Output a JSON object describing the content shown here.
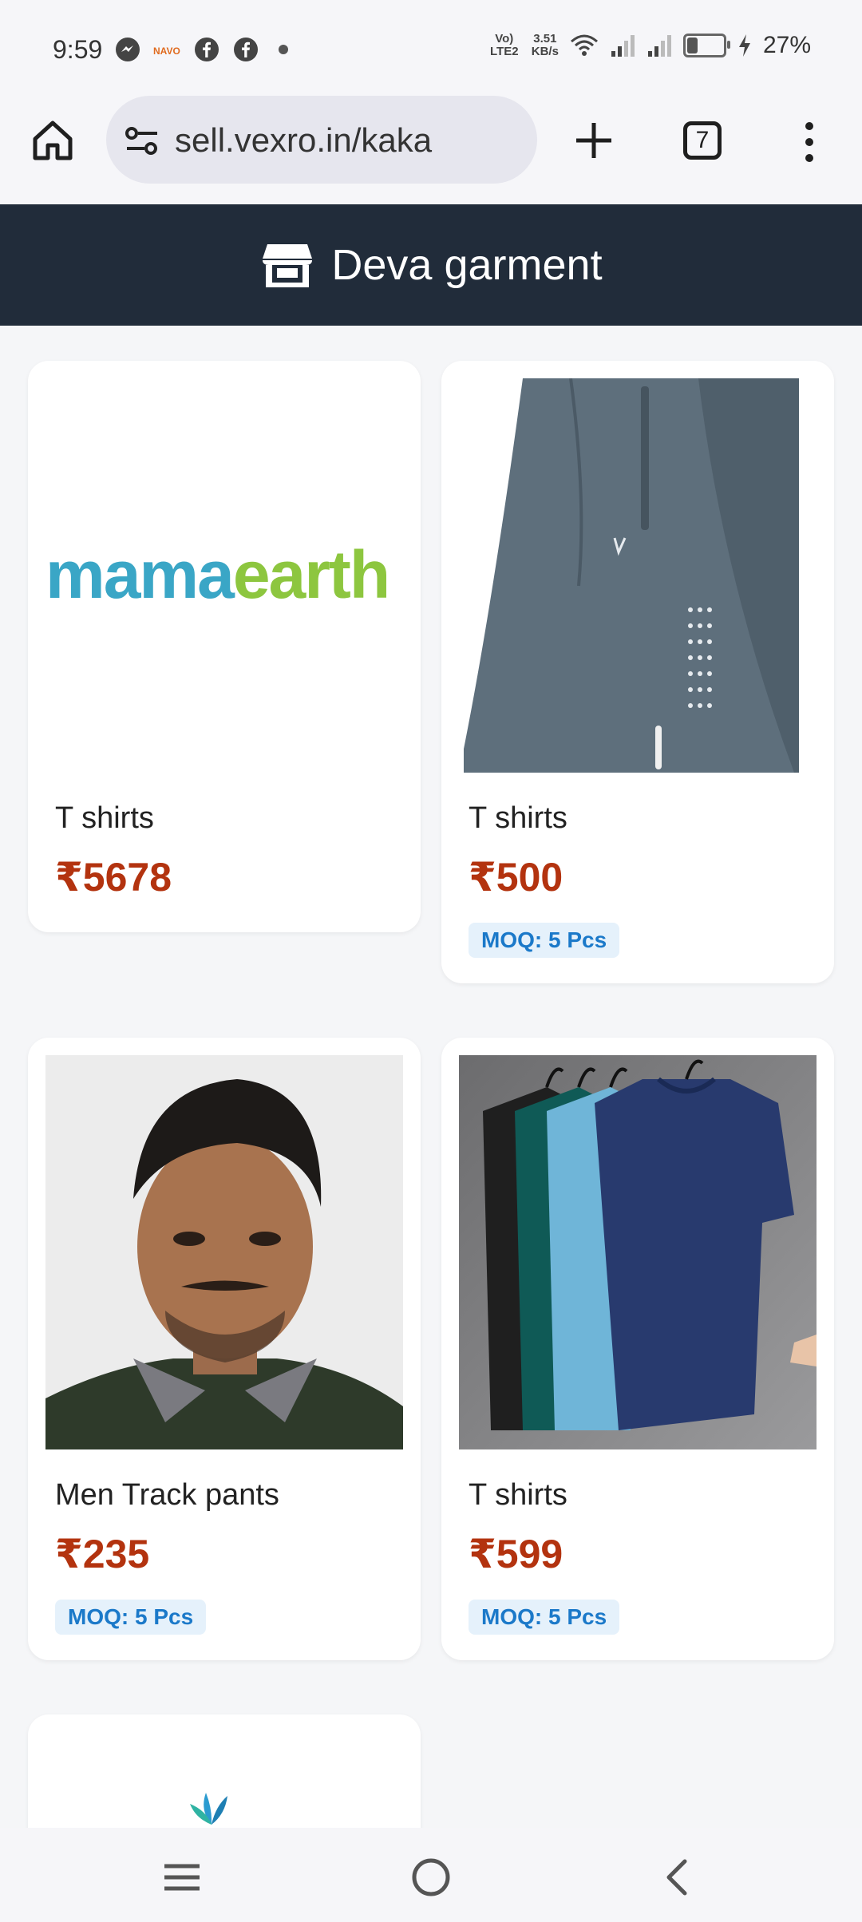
{
  "status_bar": {
    "time": "9:59",
    "network": "Vo) LTE2",
    "speed_value": "3.51",
    "speed_unit": "KB/s",
    "battery": "27%",
    "battery_level": 0.27,
    "icons": [
      "messenger-icon",
      "navo-app-icon",
      "facebook-icon",
      "facebook-icon",
      "dot-icon",
      "wifi-icon",
      "signal-icon",
      "signal-icon",
      "battery-icon",
      "charging-icon"
    ]
  },
  "browser": {
    "url": "sell.vexro.in/kaka",
    "tab_count": "7",
    "icons": [
      "home-icon",
      "site-settings-icon",
      "new-tab-icon",
      "tabs-icon",
      "more-icon"
    ]
  },
  "store": {
    "name": "Deva garment",
    "icon": "storefront-icon"
  },
  "products": [
    {
      "name": "T shirts",
      "price": "₹5678",
      "moq": "",
      "image": "mamaearth-logo",
      "logo_text_a": "mama",
      "logo_text_b": "earth"
    },
    {
      "name": "T shirts",
      "price": "₹500",
      "moq": "MOQ: 5 Pcs",
      "image": "track-pants-photo"
    },
    {
      "name": "Men Track pants",
      "price": "₹235",
      "moq": "MOQ: 5 Pcs",
      "image": "man-portrait-photo"
    },
    {
      "name": "T shirts",
      "price": "₹599",
      "moq": "MOQ: 5 Pcs",
      "image": "tshirts-on-hangers-photo"
    },
    {
      "name": "",
      "price": "",
      "moq": "",
      "image": "leaf-logo"
    }
  ],
  "colors": {
    "header_bg": "#212c3a",
    "price": "#b3330f",
    "moq_text": "#1b79c9",
    "moq_bg": "#e5f1fb",
    "mamaearth_blue": "#3aa6c6",
    "mamaearth_green": "#8dc63f"
  },
  "nav_bar": {
    "icons": [
      "recents-icon",
      "home-circle-icon",
      "back-icon"
    ]
  }
}
